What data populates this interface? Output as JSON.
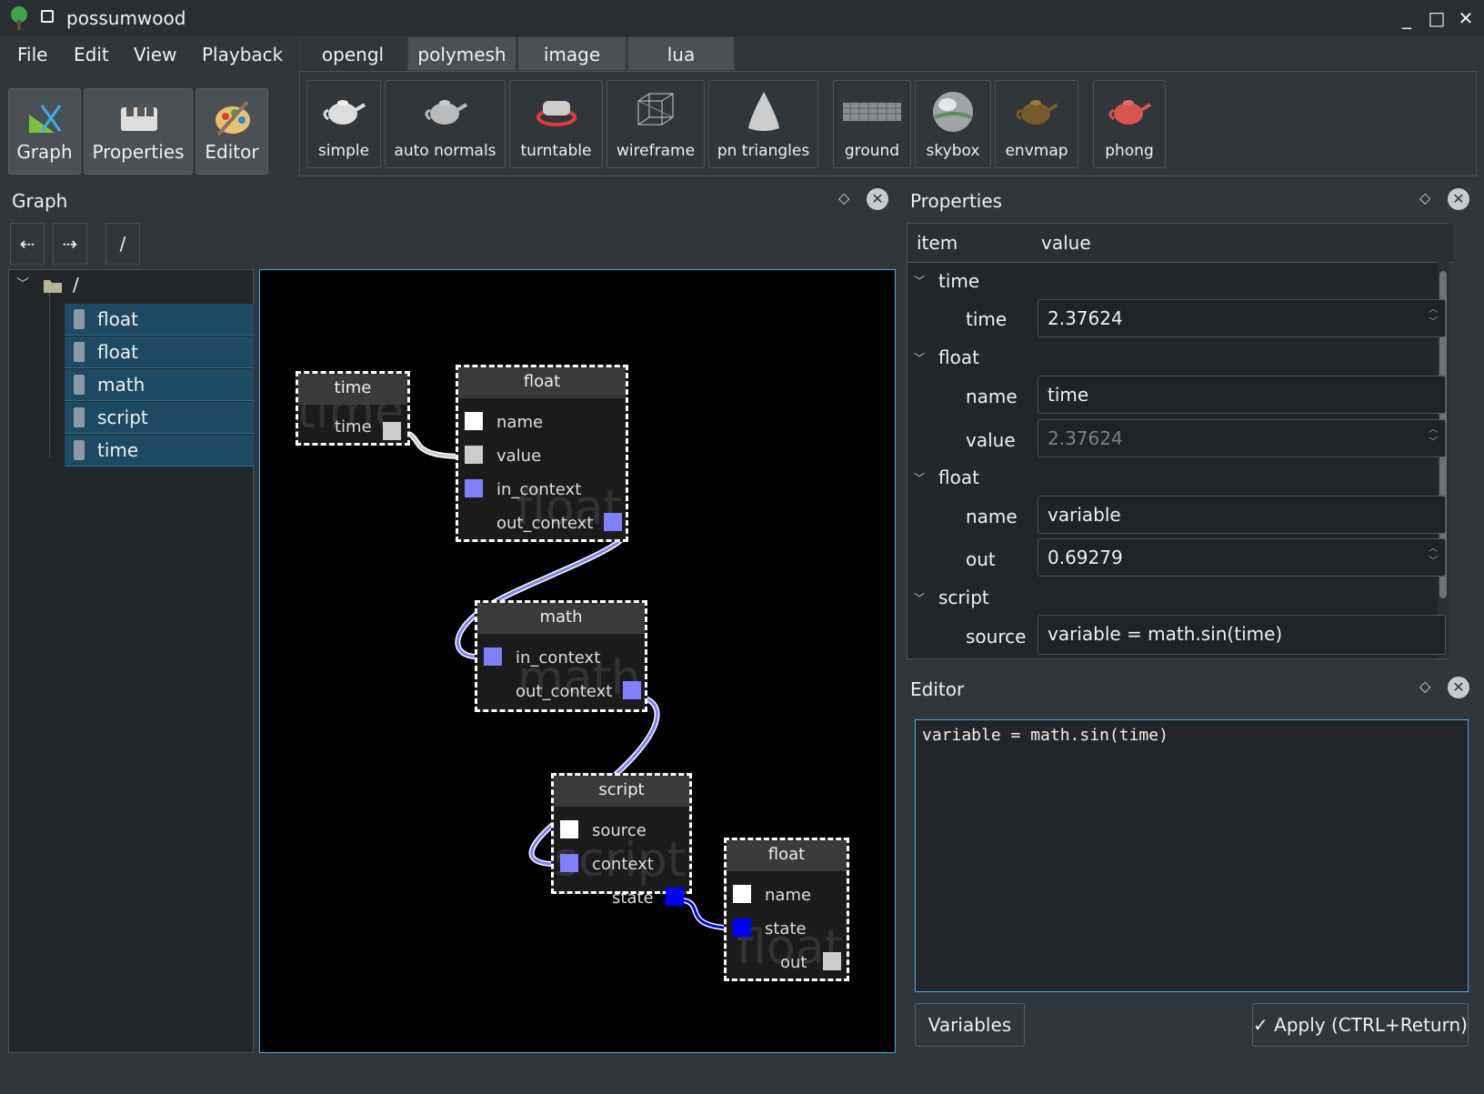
{
  "window": {
    "title": "possumwood"
  },
  "menu": [
    "File",
    "Edit",
    "View",
    "Playback"
  ],
  "main_buttons": {
    "graph": "Graph",
    "properties": "Properties",
    "editor": "Editor"
  },
  "tabs": [
    "opengl",
    "polymesh",
    "image",
    "lua"
  ],
  "tools": [
    "simple",
    "auto normals",
    "turntable",
    "wireframe",
    "pn triangles",
    "ground",
    "skybox",
    "envmap",
    "phong"
  ],
  "graph_panel": {
    "title": "Graph",
    "path": "/",
    "root": "/",
    "tree_items": [
      "float",
      "float",
      "math",
      "script",
      "time"
    ]
  },
  "nodes": {
    "time": {
      "title": "time",
      "ports": [
        "time"
      ],
      "watermark": "time"
    },
    "float1": {
      "title": "float",
      "ports": [
        "name",
        "value",
        "in_context",
        "out_context"
      ],
      "watermark": "float"
    },
    "math": {
      "title": "math",
      "ports": [
        "in_context",
        "out_context"
      ],
      "watermark": "math"
    },
    "script": {
      "title": "script",
      "ports": [
        "source",
        "context",
        "state"
      ],
      "watermark": "script"
    },
    "float2": {
      "title": "float",
      "ports": [
        "name",
        "state",
        "out"
      ],
      "watermark": "float"
    }
  },
  "properties_panel": {
    "title": "Properties",
    "col_item": "item",
    "col_value": "value",
    "rows": {
      "g_time": "time",
      "time_label": "time",
      "time_value": "2.37624",
      "g_float1": "float",
      "f1_name_label": "name",
      "f1_name_value": "time",
      "f1_value_label": "value",
      "f1_value_value": "2.37624",
      "g_float2": "float",
      "f2_name_label": "name",
      "f2_name_value": "variable",
      "f2_out_label": "out",
      "f2_out_value": "0.69279",
      "g_script": "script",
      "s_source_label": "source",
      "s_source_value": "variable = math.sin(time)"
    }
  },
  "editor_panel": {
    "title": "Editor",
    "code": "variable = math.sin(time)",
    "variables_button": "Variables",
    "apply_button": "Apply (CTRL+Return)"
  },
  "colors": {
    "accent": "#3daee9",
    "selection": "#1d4a62",
    "port_context": "#7f7fff",
    "port_state": "#0000ff",
    "port_value": "#cccccc",
    "port_string": "#ffffff"
  }
}
